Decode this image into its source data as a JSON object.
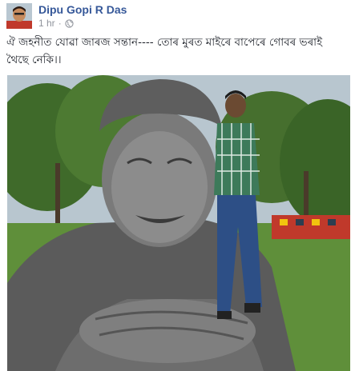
{
  "post": {
    "author_name": "Dipu Gopi R Das",
    "timestamp": "1 hr",
    "separator": "·",
    "privacy_icon": "globe-icon",
    "text": "ঐ জহনীত যোৱা জাৰজ সন্তান---- তোৰ মুৰত মাইৰে বাপেৰে গোবৰ ভৰাই থৈছে নেকি।।"
  },
  "colors": {
    "author_link": "#365899",
    "meta_text": "#90949c",
    "body_text": "#1d2129"
  }
}
